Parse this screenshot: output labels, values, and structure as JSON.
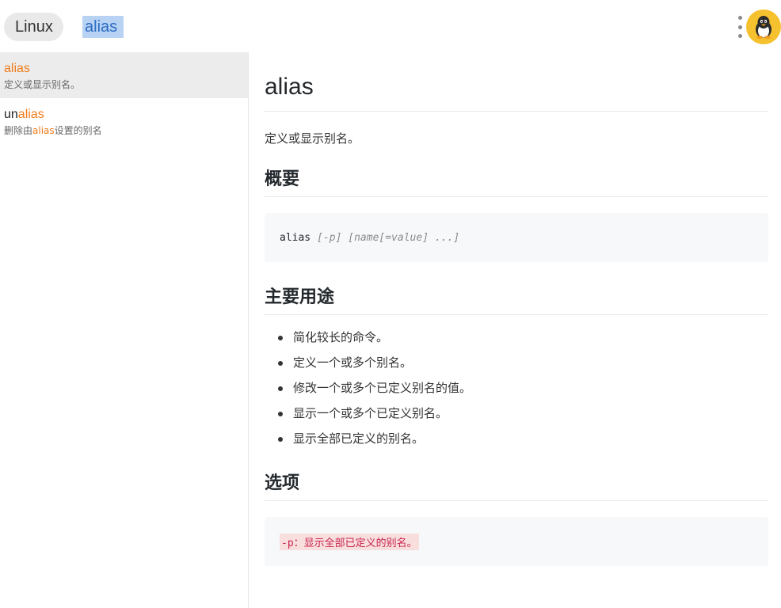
{
  "header": {
    "category_label": "Linux",
    "search_value": "alias"
  },
  "sidebar": {
    "items": [
      {
        "title_prefix": "",
        "title_match": "alias",
        "desc_before": "定义或显示别名。",
        "desc_match": "",
        "desc_after": ""
      },
      {
        "title_prefix": "un",
        "title_match": "alias",
        "desc_before": "删除由",
        "desc_match": "alias",
        "desc_after": "设置的别名"
      }
    ]
  },
  "main": {
    "title": "alias",
    "description": "定义或显示别名。",
    "synopsis_heading": "概要",
    "synopsis_command": "alias",
    "synopsis_args": "[-p] [name[=value] ...]",
    "usage_heading": "主要用途",
    "usage_items": [
      "简化较长的命令。",
      "定义一个或多个别名。",
      "修改一个或多个已定义别名的值。",
      "显示一个或多个已定义别名。",
      "显示全部已定义的别名。"
    ],
    "options_heading": "选项",
    "options_text": "-p：显示全部已定义的别名。"
  },
  "colors": {
    "highlight": "#f07a17",
    "avatar": "#f6c12f",
    "search_selection": "#b8d2f4"
  },
  "icons": [
    "more-vert-icon",
    "tux-penguin-icon"
  ]
}
